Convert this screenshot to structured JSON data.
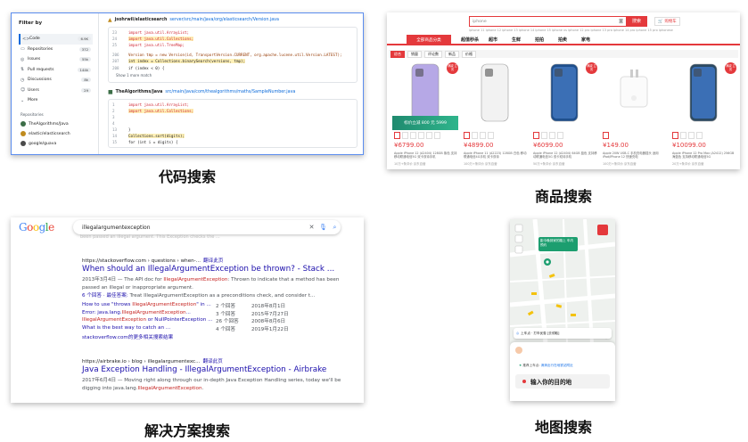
{
  "captions": {
    "code": "代码搜索",
    "product": "商品搜索",
    "solution": "解决方案搜索",
    "map": "地图搜索"
  },
  "code_search": {
    "filter_title": "Filter by",
    "filters": [
      {
        "icon": "<>",
        "label": "Code",
        "count": "6.9K"
      },
      {
        "icon": "▭",
        "label": "Repositories",
        "count": "372"
      },
      {
        "icon": "◎",
        "label": "Issues",
        "count": "55k"
      },
      {
        "icon": "⇅",
        "label": "Pull requests",
        "count": "144k"
      },
      {
        "icon": "◷",
        "label": "Discussions",
        "count": "8k"
      },
      {
        "icon": "☺",
        "label": "Users",
        "count": "29"
      },
      {
        "icon": "⌄",
        "label": "More",
        "count": ""
      }
    ],
    "repos_heading": "Repositories",
    "repos": [
      {
        "name": "TheAlgorithms/Java",
        "color": "#3c6e47"
      },
      {
        "name": "elastic/elasticsearch",
        "color": "#c08b1e"
      },
      {
        "name": "google/guava",
        "color": "#4a4a4a"
      }
    ],
    "results": [
      {
        "repo": "jsohrwil/elasticsearch",
        "path": "server/src/main/java/org/elasticsearch/Version.java",
        "lines": [
          {
            "n": "23",
            "code": "import java.util.ArrayList;"
          },
          {
            "n": "24",
            "code": "import java.util.Collections;"
          },
          {
            "n": "25",
            "code": "import java.util.TreeMap;"
          },
          {
            "n": "206",
            "code": "Version tmp = new Version(id, TransportVersion.CURRENT, org.apache.lucene.util.Version.LATEST);"
          },
          {
            "n": "207",
            "code": "int index = Collections.binarySearch(versions, tmp);"
          },
          {
            "n": "208",
            "code": "if (index < 0) {"
          }
        ],
        "more": "Show 1 more match"
      },
      {
        "repo": "TheAlgorithms/Java",
        "path": "src/main/java/com/thealgorithms/maths/SampleNumber.java",
        "lines": [
          {
            "n": "1",
            "code": "import java.util.ArrayList;"
          },
          {
            "n": "2",
            "code": "import java.util.Collections;"
          },
          {
            "n": "3",
            "code": ""
          },
          {
            "n": "4",
            "code": ""
          },
          {
            "n": "13",
            "code": "}"
          },
          {
            "n": "14",
            "code": "Collections.sort(digits);"
          },
          {
            "n": "15",
            "code": "for (int i = digits) {"
          }
        ]
      }
    ]
  },
  "product_search": {
    "query": "iphone",
    "search_button": "搜索",
    "cart": "购物车",
    "hot_words": "iphone 11  iphone 12  iphone 13  iphone 14  iphone 15  iphone xs  iphone 12 pro  iphone 13 pro  iphone 14 pro  iphone 15 pro  iphonese",
    "nav_all": "全部商品分类",
    "nav": [
      "超值秒杀",
      "超市",
      "生鲜",
      "拍拍",
      "拍卖",
      "家电"
    ],
    "sort": [
      "综合",
      "销量",
      "评论数",
      "新品",
      "价格"
    ],
    "products": [
      {
        "price": "¥6799.00",
        "desc": "Apple iPhone 12 (A2404) 128GB 紫色 支持移动联通电信5G 双卡双待手机",
        "meta": "10万+条评价  京东自营",
        "img": "purple",
        "badge": "满减 立省",
        "promo": "标价立减 800 元  5999"
      },
      {
        "price": "¥4899.00",
        "desc": "Apple iPhone 11 (A2223) 128GB 白色 移动联通电信4G手机 双卡双待",
        "meta": "100万+条评价  京东自营",
        "img": "white",
        "badge": "",
        "promo": ""
      },
      {
        "price": "¥6099.00",
        "desc": "Apple iPhone 12 (A2404) 64GB 蓝色 支持移动联通电信5G 双卡双待手机",
        "meta": "50万+条评价  京东自营",
        "img": "blue",
        "badge": "满减 立省",
        "promo": ""
      },
      {
        "price": "¥149.00",
        "desc": "Apple 20W USB-C 手机充电器插头 适用iPad/iPhone 12 快速充电",
        "meta": "100万+条评价  京东自营",
        "img": "charger",
        "badge": "",
        "promo": ""
      },
      {
        "price": "¥10099.00",
        "desc": "Apple iPhone 12 Pro Max (A2412) 256GB 海蓝色 支持移动联通电信5G",
        "meta": "20万+条评价  京东自营",
        "img": "pacific",
        "badge": "满减 立省",
        "promo": ""
      }
    ]
  },
  "solution_search": {
    "logo": "Google",
    "query": "illegalargumentexception",
    "faded_text": "been passed an illegal argument. This Exception checks the ...",
    "results": [
      {
        "url": "https://stackoverflow.com › questions › when-...",
        "translate": "翻译此页",
        "title": "When should an IllegalArgumentException be thrown? - Stack ...",
        "snippet_pre": "2013年3月4日 — The API doc for ",
        "snippet_em": "IllegalArgumentException",
        "snippet_post": ": Thrown to indicate that a method has been passed an illegal or inappropriate argument.",
        "meta_pre": "6 个回答 · 最佳答案: ",
        "meta_post": "Treat IllegalArgumentException as a preconditions check, and consider t...",
        "subs": [
          {
            "q_pre": "How to use \"throws ",
            "q_em": "IllegalArgumentException",
            "q_post": "\" in ...",
            "a": "2 个回答",
            "d": "2018年8月1日"
          },
          {
            "q_pre": "Error: java.lang.",
            "q_em": "IllegalArgumentException",
            "q_post": "...",
            "a": "3 个回答",
            "d": "2015年7月27日"
          },
          {
            "q_pre": "",
            "q_em": "IllegalArgumentException",
            "q_post": " or NullPointerException ...",
            "a": "26 个回答",
            "d": "2008年8月6日"
          },
          {
            "q_pre": "What is the best way to catch an ...",
            "q_em": "",
            "q_post": "",
            "a": "4 个回答",
            "d": "2019年1月22日"
          }
        ],
        "similar": "stackoverflow.com的更多相关搜索结果"
      },
      {
        "url": "https://airbrake.io › blog › illegalargumentexc...",
        "translate": "翻译此页",
        "title": "Java Exception Handling - IllegalArgumentException - Airbrake",
        "snippet_pre": "2017年6月4日 — Moving right along through our in-depth Java Exception Handling series, today we'll be digging into java.lang.",
        "snippet_em": "IllegalArgumentException",
        "snippet_post": "."
      }
    ]
  },
  "map_search": {
    "bubble": "距今晚到家的路上 车内预约",
    "welcome": "上车点 · 打车优惠 [去领取]",
    "promo": "推荐上车点: ",
    "promo_link": "滴滴出行在地铁站附近",
    "destination": "输入你的目的地"
  }
}
